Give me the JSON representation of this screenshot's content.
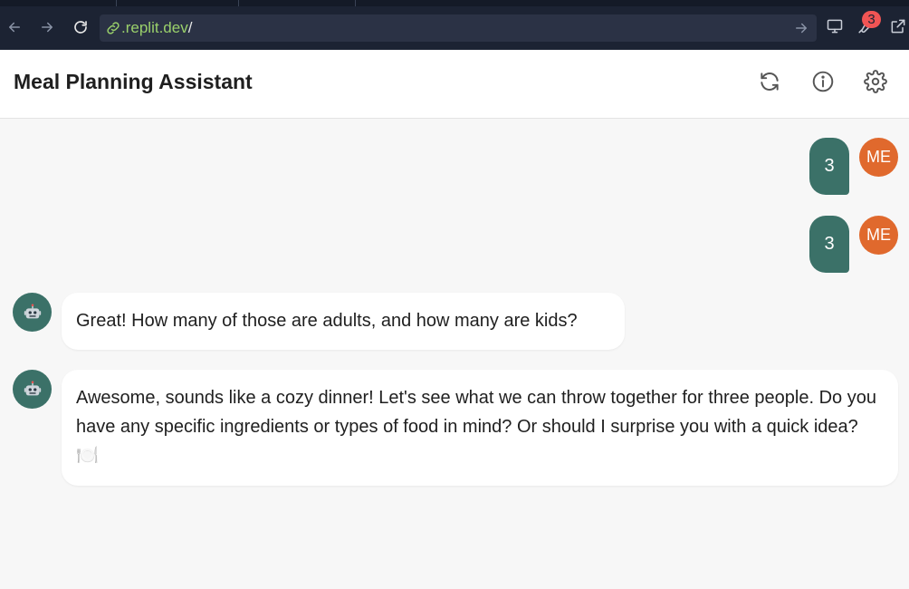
{
  "browser": {
    "url_domain": ".replit.dev",
    "url_path": "/",
    "extension_badge": "3",
    "icons": {
      "back": "arrow-left-icon",
      "forward": "arrow-right-icon",
      "reload": "reload-icon",
      "link": "link-icon",
      "go": "arrow-right-icon",
      "devices": "monitor-icon",
      "extensions": "wrench-icon",
      "open_external": "external-link-icon"
    }
  },
  "app": {
    "title": "Meal Planning Assistant",
    "actions": [
      {
        "name": "refresh",
        "icon": "refresh-icon"
      },
      {
        "name": "info",
        "icon": "info-icon"
      },
      {
        "name": "settings",
        "icon": "gear-icon"
      }
    ]
  },
  "chat": {
    "messages": [
      {
        "role": "user",
        "avatar": "ME",
        "text": "3"
      },
      {
        "role": "user",
        "avatar": "ME",
        "text": "3"
      },
      {
        "role": "assistant",
        "avatar_icon": "robot-icon",
        "text": "Great! How many of those are adults, and how many are kids?"
      },
      {
        "role": "assistant",
        "avatar_icon": "robot-icon",
        "text": "Awesome, sounds like a cozy dinner! Let's see what we can throw together for three people. Do you have any specific ingredients or types of food in mind? Or should I surprise you with a quick idea? 🍽️"
      }
    ]
  },
  "colors": {
    "chrome_bg": "#1c2333",
    "url_text": "#9ad06b",
    "user_bubble": "#3b7168",
    "user_avatar": "#e0692d",
    "bot_avatar": "#3b7168",
    "badge": "#f05454",
    "page_bg": "#f7f7f7"
  }
}
